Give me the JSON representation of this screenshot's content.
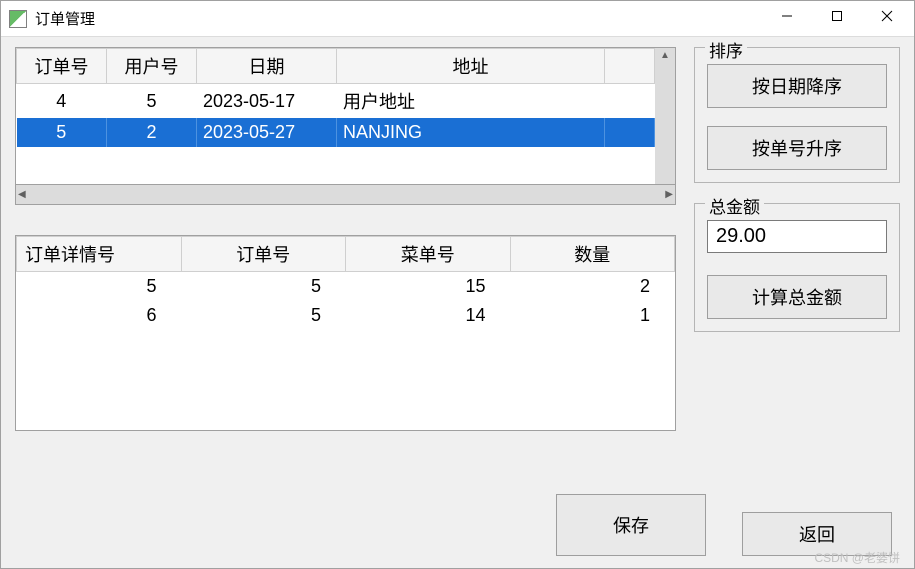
{
  "window": {
    "title": "订单管理"
  },
  "orders_table": {
    "headers": [
      "订单号",
      "用户号",
      "日期",
      "地址"
    ],
    "rows": [
      {
        "id": "4",
        "user": "5",
        "date": "2023-05-17",
        "addr": "用户地址",
        "selected": false
      },
      {
        "id": "5",
        "user": "2",
        "date": "2023-05-27",
        "addr": "NANJING",
        "selected": true
      }
    ]
  },
  "details_table": {
    "headers": [
      "订单详情号",
      "订单号",
      "菜单号",
      "数量"
    ],
    "rows": [
      {
        "detail_id": "5",
        "order_id": "5",
        "menu_id": "15",
        "qty": "2"
      },
      {
        "detail_id": "6",
        "order_id": "5",
        "menu_id": "14",
        "qty": "1"
      }
    ]
  },
  "sort_box": {
    "legend": "排序",
    "by_date_desc": "按日期降序",
    "by_id_asc": "按单号升序"
  },
  "total_box": {
    "legend": "总金额",
    "value": "29.00",
    "calc_btn": "计算总金额"
  },
  "bottom": {
    "save": "保存",
    "back": "返回"
  },
  "watermark": "CSDN @老婆饼"
}
